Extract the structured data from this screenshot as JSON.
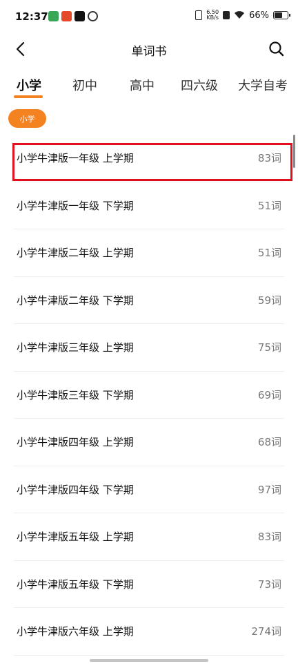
{
  "status_bar": {
    "time": "12:37",
    "net_speed_value": "6.50",
    "net_speed_unit": "KB/s",
    "battery_percent": "66%",
    "battery_level": 0.66
  },
  "nav": {
    "title": "单词书",
    "back_icon": "chevron-left-icon",
    "search_icon": "search-icon"
  },
  "tabs": [
    {
      "label": "小学",
      "active": true
    },
    {
      "label": "初中",
      "active": false
    },
    {
      "label": "高中",
      "active": false
    },
    {
      "label": "四六级",
      "active": false
    },
    {
      "label": "大学自考",
      "active": false
    }
  ],
  "filter_chip": {
    "label": "小学"
  },
  "books": [
    {
      "name": "小学牛津版一年级 上学期",
      "count": "83词"
    },
    {
      "name": "小学牛津版一年级 下学期",
      "count": "51词"
    },
    {
      "name": "小学牛津版二年级 上学期",
      "count": "51词"
    },
    {
      "name": "小学牛津版二年级 下学期",
      "count": "59词"
    },
    {
      "name": "小学牛津版三年级 上学期",
      "count": "75词"
    },
    {
      "name": "小学牛津版三年级 下学期",
      "count": "69词"
    },
    {
      "name": "小学牛津版四年级 上学期",
      "count": "68词"
    },
    {
      "name": "小学牛津版四年级 下学期",
      "count": "97词"
    },
    {
      "name": "小学牛津版五年级 上学期",
      "count": "83词"
    },
    {
      "name": "小学牛津版五年级 下学期",
      "count": "73词"
    },
    {
      "name": "小学牛津版六年级 上学期",
      "count": "274词"
    }
  ],
  "colors": {
    "accent": "#f58220",
    "highlight": "#e2101e"
  }
}
